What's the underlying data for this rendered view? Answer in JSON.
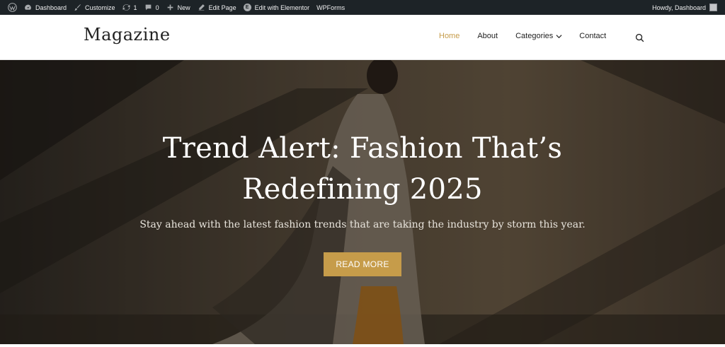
{
  "admin_bar": {
    "dashboard": "Dashboard",
    "customize": "Customize",
    "updates_count": "1",
    "comments_count": "0",
    "new": "New",
    "edit_page": "Edit Page",
    "edit_elementor": "Edit with Elementor",
    "wpforms": "WPForms",
    "howdy": "Howdy, Dashboard"
  },
  "header": {
    "logo": "Magazine",
    "nav": {
      "home": "Home",
      "about": "About",
      "categories": "Categories",
      "contact": "Contact"
    }
  },
  "hero": {
    "title_line1": "Trend Alert: Fashion That’s",
    "title_line2": "Redefining 2025",
    "subtitle": "Stay ahead with the latest fashion trends that are taking the industry by storm this year.",
    "button": "READ MORE"
  },
  "colors": {
    "accent": "#c69c4a",
    "admin_bar_bg": "#1d2327"
  }
}
